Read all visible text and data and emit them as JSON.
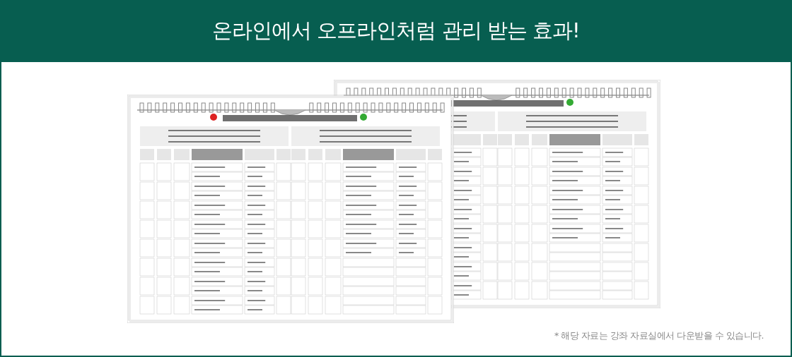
{
  "banner": {
    "title": "온라인에서 오프라인처럼 관리 받는 효과!"
  },
  "footnote": "* 해당 자료는 강좌 자료실에서 다운받을 수 있습니다."
}
